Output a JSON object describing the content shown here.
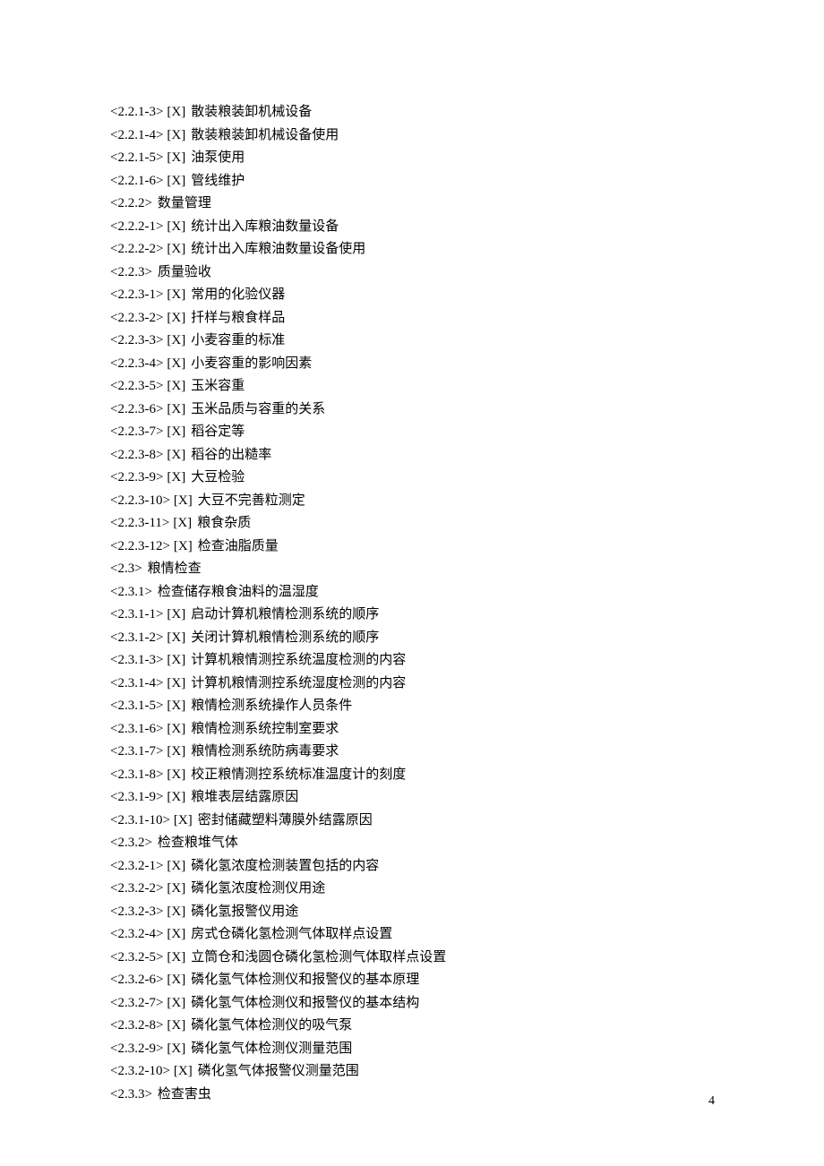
{
  "entries": [
    {
      "ref": "<2.2.1-3>",
      "mark": "[X]",
      "title": "散装粮装卸机械设备"
    },
    {
      "ref": "<2.2.1-4>",
      "mark": "[X]",
      "title": "散装粮装卸机械设备使用"
    },
    {
      "ref": "<2.2.1-5>",
      "mark": "[X]",
      "title": "油泵使用"
    },
    {
      "ref": "<2.2.1-6>",
      "mark": "[X]",
      "title": "管线维护"
    },
    {
      "ref": "<2.2.2>",
      "mark": "",
      "title": "数量管理"
    },
    {
      "ref": "<2.2.2-1>",
      "mark": "[X]",
      "title": "统计出入库粮油数量设备"
    },
    {
      "ref": "<2.2.2-2>",
      "mark": "[X]",
      "title": "统计出入库粮油数量设备使用"
    },
    {
      "ref": "<2.2.3>",
      "mark": "",
      "title": "质量验收"
    },
    {
      "ref": "<2.2.3-1>",
      "mark": "[X]",
      "title": "常用的化验仪器"
    },
    {
      "ref": "<2.2.3-2>",
      "mark": "[X]",
      "title": "扦样与粮食样品"
    },
    {
      "ref": "<2.2.3-3>",
      "mark": "[X]",
      "title": "小麦容重的标准"
    },
    {
      "ref": "<2.2.3-4>",
      "mark": "[X]",
      "title": "小麦容重的影响因素"
    },
    {
      "ref": "<2.2.3-5>",
      "mark": "[X]",
      "title": "玉米容重"
    },
    {
      "ref": "<2.2.3-6>",
      "mark": "[X]",
      "title": "玉米品质与容重的关系"
    },
    {
      "ref": "<2.2.3-7>",
      "mark": "[X]",
      "title": "稻谷定等"
    },
    {
      "ref": "<2.2.3-8>",
      "mark": "[X]",
      "title": "稻谷的出糙率"
    },
    {
      "ref": "<2.2.3-9>",
      "mark": "[X]",
      "title": "大豆检验"
    },
    {
      "ref": "<2.2.3-10>",
      "mark": "[X]",
      "title": "大豆不完善粒测定"
    },
    {
      "ref": "<2.2.3-11>",
      "mark": "[X]",
      "title": "粮食杂质"
    },
    {
      "ref": "<2.2.3-12>",
      "mark": "[X]",
      "title": "检查油脂质量"
    },
    {
      "ref": "<2.3>",
      "mark": "",
      "title": "粮情检查"
    },
    {
      "ref": "<2.3.1>",
      "mark": "",
      "title": "检查储存粮食油料的温湿度"
    },
    {
      "ref": "<2.3.1-1>",
      "mark": "[X]",
      "title": "启动计算机粮情检测系统的顺序"
    },
    {
      "ref": "<2.3.1-2>",
      "mark": "[X]",
      "title": "关闭计算机粮情检测系统的顺序"
    },
    {
      "ref": "<2.3.1-3>",
      "mark": "[X]",
      "title": "计算机粮情测控系统温度检测的内容"
    },
    {
      "ref": "<2.3.1-4>",
      "mark": "[X]",
      "title": "计算机粮情测控系统湿度检测的内容"
    },
    {
      "ref": "<2.3.1-5>",
      "mark": "[X]",
      "title": "粮情检测系统操作人员条件"
    },
    {
      "ref": "<2.3.1-6>",
      "mark": "[X]",
      "title": "粮情检测系统控制室要求"
    },
    {
      "ref": "<2.3.1-7>",
      "mark": "[X]",
      "title": "粮情检测系统防病毒要求"
    },
    {
      "ref": "<2.3.1-8>",
      "mark": "[X]",
      "title": "校正粮情测控系统标准温度计的刻度"
    },
    {
      "ref": "<2.3.1-9>",
      "mark": "[X]",
      "title": "粮堆表层结露原因"
    },
    {
      "ref": "<2.3.1-10>",
      "mark": "[X]",
      "title": "密封储藏塑料薄膜外结露原因"
    },
    {
      "ref": "<2.3.2>",
      "mark": "",
      "title": "检查粮堆气体"
    },
    {
      "ref": "<2.3.2-1>",
      "mark": "[X]",
      "title": "磷化氢浓度检测装置包括的内容"
    },
    {
      "ref": "<2.3.2-2>",
      "mark": "[X]",
      "title": "磷化氢浓度检测仪用途"
    },
    {
      "ref": "<2.3.2-3>",
      "mark": "[X]",
      "title": "磷化氢报警仪用途"
    },
    {
      "ref": "<2.3.2-4>",
      "mark": "[X]",
      "title": "房式仓磷化氢检测气体取样点设置"
    },
    {
      "ref": "<2.3.2-5>",
      "mark": "[X]",
      "title": "立筒仓和浅圆仓磷化氢检测气体取样点设置"
    },
    {
      "ref": "<2.3.2-6>",
      "mark": "[X]",
      "title": "磷化氢气体检测仪和报警仪的基本原理"
    },
    {
      "ref": "<2.3.2-7>",
      "mark": "[X]",
      "title": "磷化氢气体检测仪和报警仪的基本结构"
    },
    {
      "ref": "<2.3.2-8>",
      "mark": "[X]",
      "title": "磷化氢气体检测仪的吸气泵"
    },
    {
      "ref": "<2.3.2-9>",
      "mark": "[X]",
      "title": "磷化氢气体检测仪测量范围"
    },
    {
      "ref": "<2.3.2-10>",
      "mark": "[X]",
      "title": "磷化氢气体报警仪测量范围"
    },
    {
      "ref": "<2.3.3>",
      "mark": "",
      "title": "检查害虫"
    }
  ],
  "pageNumber": "4"
}
